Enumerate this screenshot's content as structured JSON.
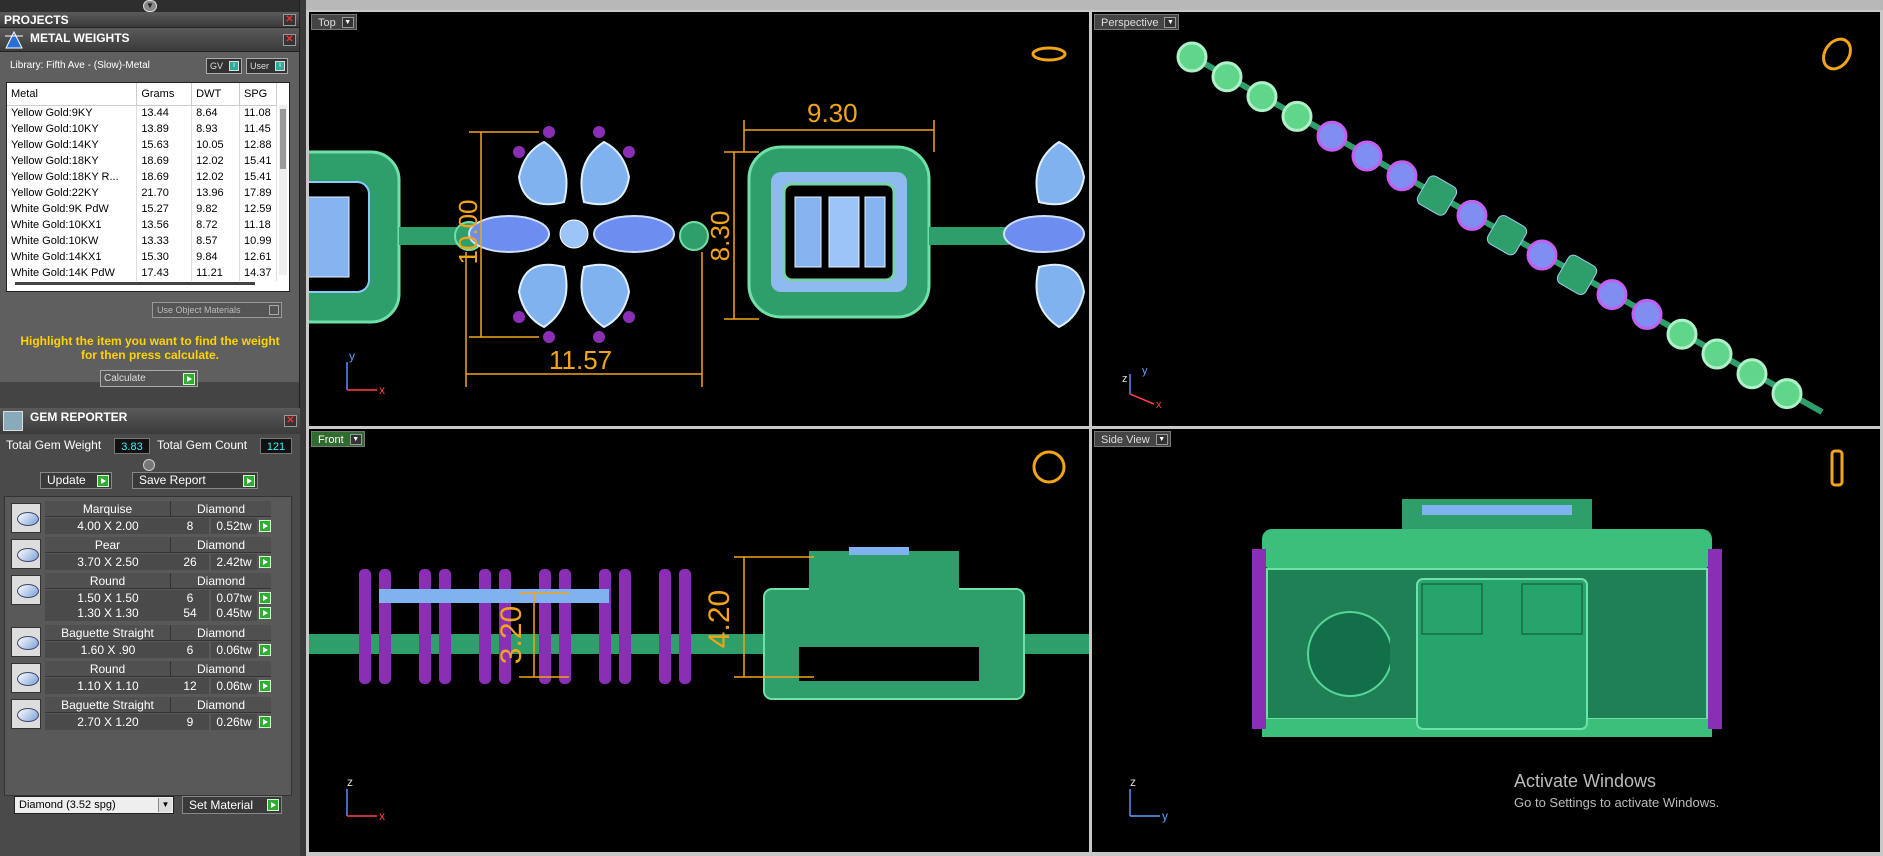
{
  "panels": {
    "projects_title": "PROJECTS",
    "metal_title": "METAL WEIGHTS",
    "library": "Library: Fifth Ave - (Slow)-Metal",
    "gv_label": "GV",
    "user_label": "User",
    "columns": [
      "Metal",
      "Grams",
      "DWT",
      "SPG"
    ],
    "rows": [
      [
        "Yellow Gold:9KY",
        "13.44",
        "8.64",
        "11.08"
      ],
      [
        "Yellow Gold:10KY",
        "13.89",
        "8.93",
        "11.45"
      ],
      [
        "Yellow Gold:14KY",
        "15.63",
        "10.05",
        "12.88"
      ],
      [
        "Yellow Gold:18KY",
        "18.69",
        "12.02",
        "15.41"
      ],
      [
        "Yellow Gold:18KY R...",
        "18.69",
        "12.02",
        "15.41"
      ],
      [
        "Yellow Gold:22KY",
        "21.70",
        "13.96",
        "17.89"
      ],
      [
        "White Gold:9K PdW",
        "15.27",
        "9.82",
        "12.59"
      ],
      [
        "White Gold:10KX1",
        "13.56",
        "8.72",
        "11.18"
      ],
      [
        "White Gold:10KW",
        "13.33",
        "8.57",
        "10.99"
      ],
      [
        "White Gold:14KX1",
        "15.30",
        "9.84",
        "12.61"
      ],
      [
        "White Gold:14K PdW",
        "17.43",
        "11.21",
        "14.37"
      ]
    ],
    "use_object": "Use Object Materials",
    "hint_line1": "Highlight the item you want to find the weight",
    "hint_line2": "for then press calculate.",
    "calculate": "Calculate"
  },
  "gem": {
    "title": "GEM REPORTER",
    "total_weight_label": "Total Gem Weight",
    "total_weight": "3.83",
    "total_count_label": "Total Gem Count",
    "total_count": "121",
    "update": "Update",
    "save_report": "Save Report",
    "items": [
      {
        "shape": "Marquise",
        "type": "Diamond",
        "sizes": [
          {
            "size": "4.00 X 2.00",
            "count": "8",
            "tw": "0.52tw"
          }
        ]
      },
      {
        "shape": "Pear",
        "type": "Diamond",
        "sizes": [
          {
            "size": "3.70 X 2.50",
            "count": "26",
            "tw": "2.42tw"
          }
        ]
      },
      {
        "shape": "Round",
        "type": "Diamond",
        "sizes": [
          {
            "size": "1.50 X 1.50",
            "count": "6",
            "tw": "0.07tw"
          },
          {
            "size": "1.30 X 1.30",
            "count": "54",
            "tw": "0.45tw"
          }
        ]
      },
      {
        "shape": "Baguette Straight",
        "type": "Diamond",
        "sizes": [
          {
            "size": "1.60 X .90",
            "count": "6",
            "tw": "0.06tw"
          }
        ]
      },
      {
        "shape": "Round",
        "type": "Diamond",
        "sizes": [
          {
            "size": "1.10 X 1.10",
            "count": "12",
            "tw": "0.06tw"
          }
        ]
      },
      {
        "shape": "Baguette Straight",
        "type": "Diamond",
        "sizes": [
          {
            "size": "2.70 X 1.20",
            "count": "9",
            "tw": "0.26tw"
          }
        ]
      }
    ],
    "material": "Diamond     (3.52 spg)",
    "set_material": "Set Material"
  },
  "viewports": {
    "top": "Top",
    "perspective": "Perspective",
    "front": "Front",
    "side": "Side View"
  },
  "dimensions": {
    "top_a": "9.30",
    "top_b": "10.00",
    "top_c": "8.30",
    "top_d": "11.57",
    "front_a": "3.20",
    "front_b": "4.20"
  },
  "axes": {
    "x": "x",
    "y": "y",
    "z": "z"
  },
  "watermark": {
    "title": "Activate Windows",
    "subtitle": "Go to Settings to activate Windows."
  },
  "colors": {
    "metal_green": "#2e9e6a",
    "gem_blue": "#7fb2ee",
    "prong_purple": "#8a2fb5",
    "dim_orange": "#f2a516",
    "hint_yellow": "#ffd400"
  }
}
